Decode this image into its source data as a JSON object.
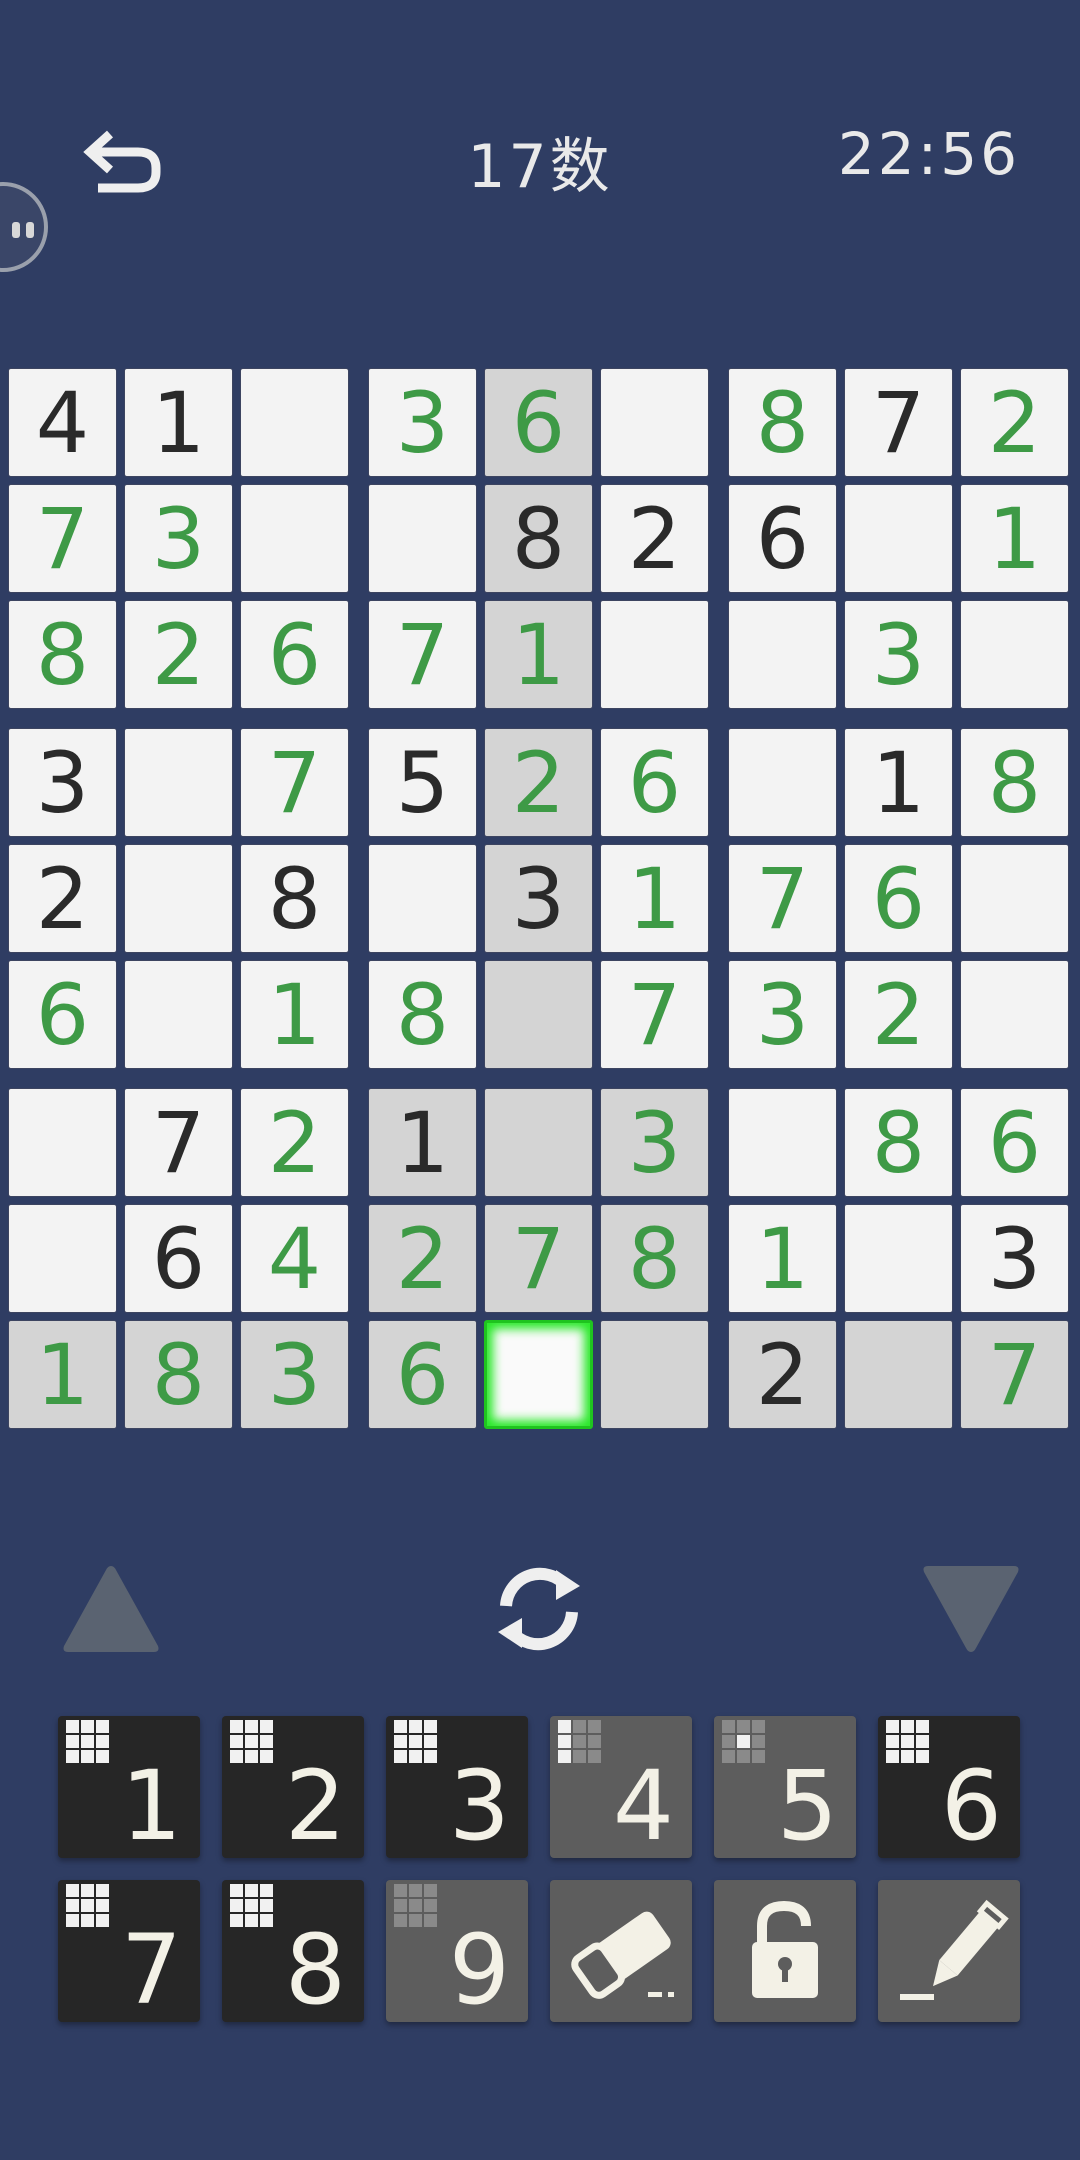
{
  "header": {
    "title": "17数",
    "timer": "22:56"
  },
  "board": {
    "cells": [
      [
        {
          "v": "4",
          "t": "given"
        },
        {
          "v": "1",
          "t": "given"
        },
        {
          "v": "",
          "t": ""
        },
        {
          "v": "3",
          "t": "user"
        },
        {
          "v": "6",
          "t": "user"
        },
        {
          "v": "",
          "t": ""
        },
        {
          "v": "8",
          "t": "user"
        },
        {
          "v": "7",
          "t": "given"
        },
        {
          "v": "2",
          "t": "user"
        }
      ],
      [
        {
          "v": "7",
          "t": "user"
        },
        {
          "v": "3",
          "t": "user"
        },
        {
          "v": "",
          "t": ""
        },
        {
          "v": "",
          "t": ""
        },
        {
          "v": "8",
          "t": "given"
        },
        {
          "v": "2",
          "t": "given"
        },
        {
          "v": "6",
          "t": "given"
        },
        {
          "v": "",
          "t": ""
        },
        {
          "v": "1",
          "t": "user"
        }
      ],
      [
        {
          "v": "8",
          "t": "user"
        },
        {
          "v": "2",
          "t": "user"
        },
        {
          "v": "6",
          "t": "user"
        },
        {
          "v": "7",
          "t": "user"
        },
        {
          "v": "1",
          "t": "user"
        },
        {
          "v": "",
          "t": ""
        },
        {
          "v": "",
          "t": ""
        },
        {
          "v": "3",
          "t": "user"
        },
        {
          "v": "",
          "t": ""
        }
      ],
      [
        {
          "v": "3",
          "t": "given"
        },
        {
          "v": "",
          "t": ""
        },
        {
          "v": "7",
          "t": "user"
        },
        {
          "v": "5",
          "t": "given"
        },
        {
          "v": "2",
          "t": "user"
        },
        {
          "v": "6",
          "t": "user"
        },
        {
          "v": "",
          "t": ""
        },
        {
          "v": "1",
          "t": "given"
        },
        {
          "v": "8",
          "t": "user"
        }
      ],
      [
        {
          "v": "2",
          "t": "given"
        },
        {
          "v": "",
          "t": ""
        },
        {
          "v": "8",
          "t": "given"
        },
        {
          "v": "",
          "t": ""
        },
        {
          "v": "3",
          "t": "given"
        },
        {
          "v": "1",
          "t": "user"
        },
        {
          "v": "7",
          "t": "user"
        },
        {
          "v": "6",
          "t": "user"
        },
        {
          "v": "",
          "t": ""
        }
      ],
      [
        {
          "v": "6",
          "t": "user"
        },
        {
          "v": "",
          "t": ""
        },
        {
          "v": "1",
          "t": "user"
        },
        {
          "v": "8",
          "t": "user"
        },
        {
          "v": "",
          "t": ""
        },
        {
          "v": "7",
          "t": "user"
        },
        {
          "v": "3",
          "t": "user"
        },
        {
          "v": "2",
          "t": "user"
        },
        {
          "v": "",
          "t": ""
        }
      ],
      [
        {
          "v": "",
          "t": ""
        },
        {
          "v": "7",
          "t": "given"
        },
        {
          "v": "2",
          "t": "user"
        },
        {
          "v": "1",
          "t": "given"
        },
        {
          "v": "",
          "t": ""
        },
        {
          "v": "3",
          "t": "user"
        },
        {
          "v": "",
          "t": ""
        },
        {
          "v": "8",
          "t": "user"
        },
        {
          "v": "6",
          "t": "user"
        }
      ],
      [
        {
          "v": "",
          "t": ""
        },
        {
          "v": "6",
          "t": "given"
        },
        {
          "v": "4",
          "t": "user"
        },
        {
          "v": "2",
          "t": "user"
        },
        {
          "v": "7",
          "t": "user"
        },
        {
          "v": "8",
          "t": "user"
        },
        {
          "v": "1",
          "t": "user"
        },
        {
          "v": "",
          "t": ""
        },
        {
          "v": "3",
          "t": "given"
        }
      ],
      [
        {
          "v": "1",
          "t": "user"
        },
        {
          "v": "8",
          "t": "user"
        },
        {
          "v": "3",
          "t": "user"
        },
        {
          "v": "6",
          "t": "user"
        },
        {
          "v": "",
          "t": ""
        },
        {
          "v": "",
          "t": ""
        },
        {
          "v": "2",
          "t": "given"
        },
        {
          "v": "",
          "t": ""
        },
        {
          "v": "7",
          "t": "user"
        }
      ]
    ],
    "selected": {
      "row": 8,
      "col": 4
    },
    "colors": {
      "given": "#2a2a2a",
      "user": "#3e9a46",
      "highlight": "#d4d4d4",
      "selected_glow": "#29e829"
    }
  },
  "controls": {
    "up": "triangle-up-icon",
    "refresh": "refresh-icon",
    "down": "triangle-down-icon"
  },
  "keypad": [
    {
      "label": "1",
      "style": "dark",
      "mini": [
        1,
        1,
        1,
        1,
        1,
        1,
        1,
        1,
        1
      ]
    },
    {
      "label": "2",
      "style": "dark",
      "mini": [
        1,
        1,
        1,
        1,
        1,
        1,
        1,
        1,
        1
      ]
    },
    {
      "label": "3",
      "style": "dark",
      "mini": [
        1,
        1,
        1,
        1,
        1,
        1,
        1,
        1,
        1
      ]
    },
    {
      "label": "4",
      "style": "gray",
      "mini": [
        1,
        0,
        0,
        1,
        0,
        0,
        1,
        0,
        0
      ]
    },
    {
      "label": "5",
      "style": "gray",
      "mini": [
        0,
        0,
        0,
        0,
        1,
        0,
        0,
        0,
        0
      ]
    },
    {
      "label": "6",
      "style": "dark",
      "mini": [
        1,
        1,
        1,
        1,
        1,
        1,
        1,
        1,
        1
      ]
    },
    {
      "label": "7",
      "style": "dark",
      "mini": [
        1,
        1,
        1,
        1,
        1,
        1,
        1,
        1,
        1
      ]
    },
    {
      "label": "8",
      "style": "dark",
      "mini": [
        1,
        1,
        1,
        1,
        1,
        1,
        1,
        1,
        1
      ]
    },
    {
      "label": "9",
      "style": "gray",
      "mini": [
        0,
        0,
        0,
        0,
        0,
        0,
        0,
        0,
        0
      ]
    },
    {
      "label": "",
      "style": "gray",
      "icon": "eraser-icon"
    },
    {
      "label": "",
      "style": "gray",
      "icon": "lock-icon"
    },
    {
      "label": "",
      "style": "gray",
      "icon": "pencil-icon"
    }
  ]
}
